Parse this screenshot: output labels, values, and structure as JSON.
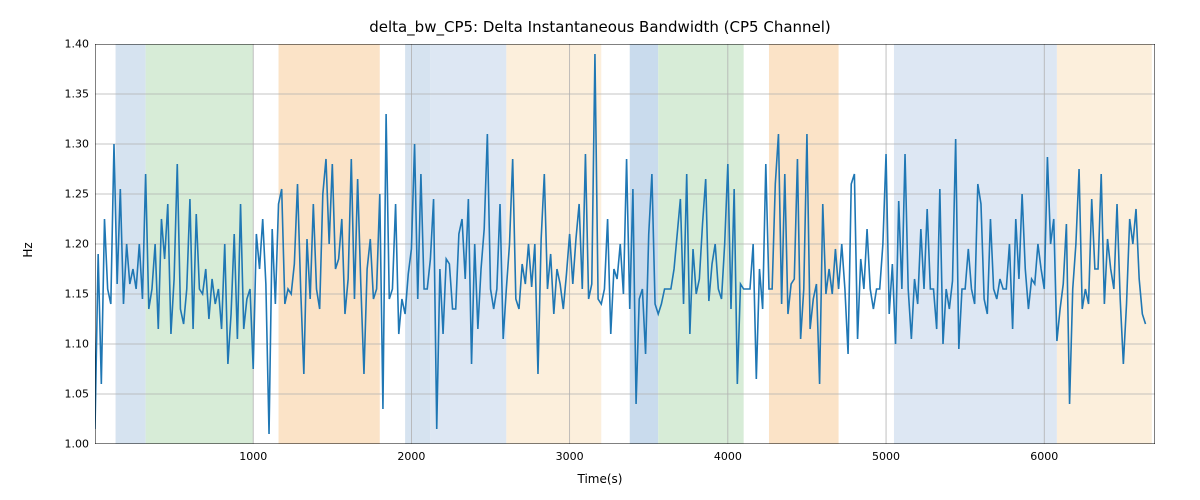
{
  "chart_data": {
    "type": "line",
    "title": "delta_bw_CP5: Delta Instantaneous Bandwidth (CP5 Channel)",
    "xlabel": "Time(s)",
    "ylabel": "Hz",
    "xlim": [
      0,
      6700
    ],
    "ylim": [
      1.0,
      1.4
    ],
    "xticks": [
      1000,
      2000,
      3000,
      4000,
      5000,
      6000
    ],
    "yticks": [
      1.0,
      1.05,
      1.1,
      1.15,
      1.2,
      1.25,
      1.3,
      1.35,
      1.4
    ],
    "shaded_regions": [
      {
        "x0": 130,
        "x1": 320,
        "color": "#d6e3f0"
      },
      {
        "x0": 320,
        "x1": 1000,
        "color": "#d7ecd7"
      },
      {
        "x0": 1160,
        "x1": 1800,
        "color": "#fbe3c7"
      },
      {
        "x0": 1960,
        "x1": 2120,
        "color": "#d6e3f0"
      },
      {
        "x0": 2120,
        "x1": 2600,
        "color": "#dde7f3"
      },
      {
        "x0": 2600,
        "x1": 3200,
        "color": "#fcefdc"
      },
      {
        "x0": 3380,
        "x1": 3560,
        "color": "#c9dbed"
      },
      {
        "x0": 3560,
        "x1": 4100,
        "color": "#d7ecd7"
      },
      {
        "x0": 4260,
        "x1": 4700,
        "color": "#fbe3c7"
      },
      {
        "x0": 5050,
        "x1": 6080,
        "color": "#dde7f3"
      },
      {
        "x0": 6080,
        "x1": 6680,
        "color": "#fcefdc"
      }
    ],
    "series": [
      {
        "name": "delta_bw_CP5",
        "color": "#1f77b4",
        "x_step": 20,
        "values": [
          1.015,
          1.19,
          1.06,
          1.225,
          1.155,
          1.14,
          1.3,
          1.16,
          1.255,
          1.14,
          1.2,
          1.16,
          1.175,
          1.155,
          1.2,
          1.145,
          1.27,
          1.135,
          1.155,
          1.2,
          1.115,
          1.225,
          1.185,
          1.24,
          1.11,
          1.165,
          1.28,
          1.135,
          1.12,
          1.155,
          1.245,
          1.115,
          1.23,
          1.155,
          1.15,
          1.175,
          1.125,
          1.165,
          1.14,
          1.155,
          1.115,
          1.2,
          1.08,
          1.13,
          1.21,
          1.105,
          1.24,
          1.115,
          1.145,
          1.155,
          1.075,
          1.21,
          1.175,
          1.225,
          1.16,
          1.01,
          1.215,
          1.14,
          1.24,
          1.255,
          1.14,
          1.155,
          1.15,
          1.18,
          1.26,
          1.155,
          1.07,
          1.205,
          1.145,
          1.24,
          1.155,
          1.135,
          1.25,
          1.285,
          1.2,
          1.28,
          1.175,
          1.185,
          1.225,
          1.13,
          1.165,
          1.285,
          1.145,
          1.265,
          1.16,
          1.07,
          1.175,
          1.205,
          1.145,
          1.155,
          1.25,
          1.035,
          1.33,
          1.145,
          1.155,
          1.24,
          1.11,
          1.145,
          1.13,
          1.17,
          1.195,
          1.3,
          1.145,
          1.27,
          1.155,
          1.155,
          1.185,
          1.245,
          1.015,
          1.175,
          1.11,
          1.185,
          1.18,
          1.135,
          1.135,
          1.21,
          1.225,
          1.165,
          1.245,
          1.08,
          1.2,
          1.115,
          1.175,
          1.215,
          1.31,
          1.155,
          1.135,
          1.155,
          1.24,
          1.105,
          1.155,
          1.2,
          1.285,
          1.145,
          1.135,
          1.18,
          1.16,
          1.2,
          1.157,
          1.2,
          1.07,
          1.205,
          1.27,
          1.155,
          1.19,
          1.13,
          1.175,
          1.16,
          1.135,
          1.17,
          1.21,
          1.16,
          1.205,
          1.24,
          1.155,
          1.29,
          1.145,
          1.16,
          1.39,
          1.145,
          1.14,
          1.155,
          1.225,
          1.11,
          1.175,
          1.165,
          1.2,
          1.15,
          1.285,
          1.135,
          1.255,
          1.04,
          1.145,
          1.155,
          1.09,
          1.21,
          1.27,
          1.14,
          1.13,
          1.14,
          1.155,
          1.155,
          1.155,
          1.175,
          1.21,
          1.245,
          1.14,
          1.27,
          1.11,
          1.195,
          1.15,
          1.165,
          1.22,
          1.265,
          1.143,
          1.18,
          1.2,
          1.155,
          1.145,
          1.2,
          1.28,
          1.135,
          1.255,
          1.06,
          1.16,
          1.155,
          1.155,
          1.155,
          1.2,
          1.065,
          1.175,
          1.135,
          1.28,
          1.155,
          1.155,
          1.26,
          1.31,
          1.14,
          1.27,
          1.13,
          1.16,
          1.165,
          1.285,
          1.105,
          1.155,
          1.31,
          1.115,
          1.145,
          1.16,
          1.06,
          1.24,
          1.15,
          1.175,
          1.15,
          1.195,
          1.155,
          1.2,
          1.155,
          1.09,
          1.26,
          1.27,
          1.105,
          1.185,
          1.155,
          1.215,
          1.155,
          1.135,
          1.155,
          1.155,
          1.2,
          1.29,
          1.13,
          1.18,
          1.1,
          1.243,
          1.155,
          1.29,
          1.155,
          1.105,
          1.165,
          1.14,
          1.215,
          1.155,
          1.235,
          1.155,
          1.155,
          1.115,
          1.255,
          1.1,
          1.155,
          1.135,
          1.163,
          1.305,
          1.095,
          1.155,
          1.155,
          1.195,
          1.155,
          1.14,
          1.26,
          1.24,
          1.145,
          1.13,
          1.225,
          1.155,
          1.145,
          1.165,
          1.155,
          1.155,
          1.2,
          1.115,
          1.225,
          1.165,
          1.25,
          1.175,
          1.135,
          1.165,
          1.16,
          1.2,
          1.175,
          1.155,
          1.287,
          1.2,
          1.225,
          1.103,
          1.135,
          1.16,
          1.22,
          1.04,
          1.155,
          1.2,
          1.275,
          1.135,
          1.155,
          1.14,
          1.245,
          1.175,
          1.175,
          1.27,
          1.14,
          1.205,
          1.175,
          1.155,
          1.24,
          1.145,
          1.08,
          1.14,
          1.225,
          1.2,
          1.235,
          1.165,
          1.13,
          1.12
        ]
      }
    ]
  }
}
